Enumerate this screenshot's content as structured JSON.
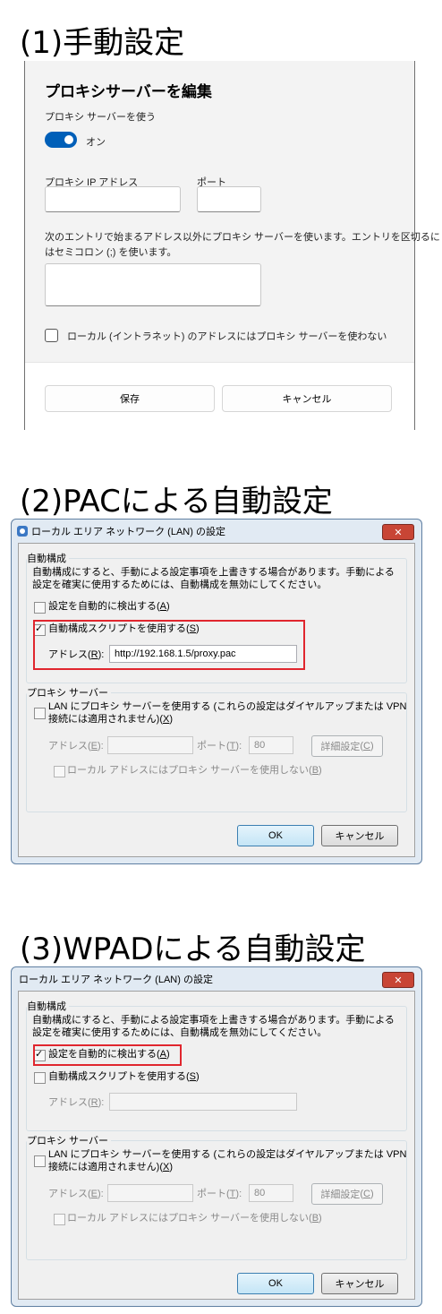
{
  "headings": {
    "h1": "(1)手動設定",
    "h2": "(2)PACによる自動設定",
    "h3": "(3)WPADによる自動設定"
  },
  "panel1": {
    "title": "プロキシサーバーを編集",
    "use_proxy_label": "プロキシ サーバーを使う",
    "toggle_state": "オン",
    "ip_label": "プロキシ IP アドレス",
    "port_label": "ポート",
    "ip_value": "",
    "port_value": "",
    "exceptions_desc_1": "次のエントリで始まるアドレス以外にプロキシ サーバーを使います。エントリを区切るに",
    "exceptions_desc_2": "はセミコロン (;) を使います。",
    "exceptions_value": "",
    "local_checkbox_label": "ローカル (イントラネット) のアドレスにはプロキシ サーバーを使わない",
    "save_button": "保存",
    "cancel_button": "キャンセル"
  },
  "dialog_common": {
    "title": "ローカル エリア ネットワーク (LAN) の設定",
    "close_glyph": "✕",
    "auto_group": "自動構成",
    "auto_desc_1": "自動構成にすると、手動による設定事項を上書きする場合があります。手動による",
    "auto_desc_2": "設定を確実に使用するためには、自動構成を無効にしてください。",
    "auto_detect_label": "設定を自動的に検出する",
    "auto_detect_key": "A",
    "script_label": "自動構成スクリプトを使用する",
    "script_key": "S",
    "address_label": "アドレス",
    "address_key": "R",
    "proxy_group": "プロキシ サーバー",
    "lan_proxy_line1": "LAN にプロキシ サーバーを使用する (これらの設定はダイヤルアップまたは VPN",
    "lan_proxy_line2": "接続には適用されません)",
    "lan_proxy_key": "X",
    "proxy_address_label": "アドレス",
    "proxy_address_key": "E",
    "port_label": "ポート",
    "port_key": "T",
    "port_value": "80",
    "advanced_button": "詳細設定",
    "advanced_key": "C",
    "bypass_local_label": "ローカル アドレスにはプロキシ サーバーを使用しない",
    "bypass_local_key": "B",
    "ok_button": "OK",
    "cancel_button": "キャンセル"
  },
  "dialog2": {
    "auto_detect_checked": false,
    "script_checked": true,
    "script_address": "http://192.168.1.5/proxy.pac"
  },
  "dialog3": {
    "auto_detect_checked": true,
    "script_checked": false,
    "script_address": ""
  },
  "colors": {
    "highlight_box": "#e0262e",
    "toggle_on": "#005fb8"
  }
}
